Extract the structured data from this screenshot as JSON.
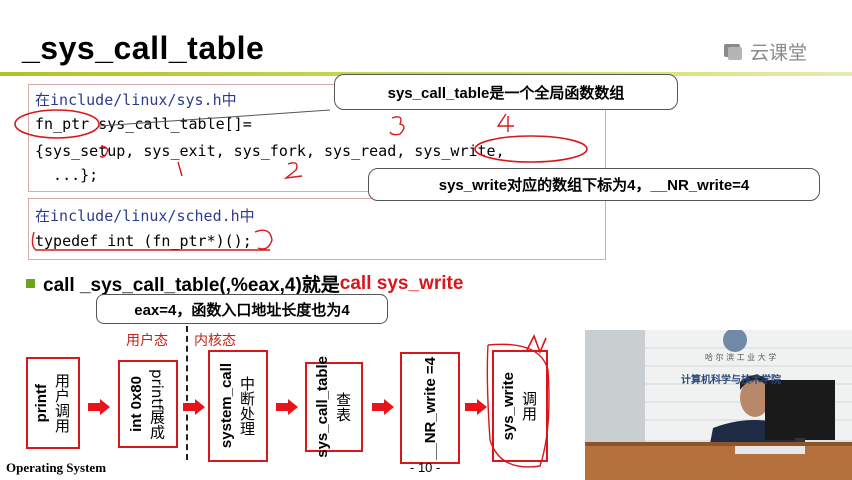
{
  "slide": {
    "title": "_sys_call_table",
    "brand": "云课堂",
    "box1": {
      "include_prefix": "在",
      "include_path": "include/linux/sys.h",
      "include_suffix": "中",
      "line2": "fn_ptr sys_call_table[]=",
      "line3": "{sys_setup, sys_exit, sys_fork, sys_read, sys_write,",
      "line4": "  ...};"
    },
    "box2": {
      "include_prefix": "在",
      "include_path": "include/linux/sched.h",
      "include_suffix": "中",
      "line2": "typedef int (fn_ptr*)();"
    },
    "callout_top": "sys_call_table是一个全局函数数组",
    "callout_right": "sys_write对应的数组下标为4，__NR_write=4",
    "bullet": {
      "text_black": "call _sys_call_table(,%eax,4)就是",
      "text_red": "call sys_write"
    },
    "callout_eax": "eax=4，函数入口地址长度也为4",
    "user_state": "用户态",
    "kernel_state": "内核态",
    "flow": [
      {
        "main": "printf",
        "side": "用户调用"
      },
      {
        "main": "int 0x80",
        "side": "printf展成"
      },
      {
        "main": "system_call",
        "side": "中断处理"
      },
      {
        "main": "sys_call_table",
        "side": "查表"
      },
      {
        "main": "__NR_write =4",
        "side": ""
      },
      {
        "main": "sys_write",
        "side": "调用"
      }
    ],
    "footer": "Operating System",
    "page_number": "- 10 -",
    "video_sign": "计算机科学与技术学院"
  }
}
